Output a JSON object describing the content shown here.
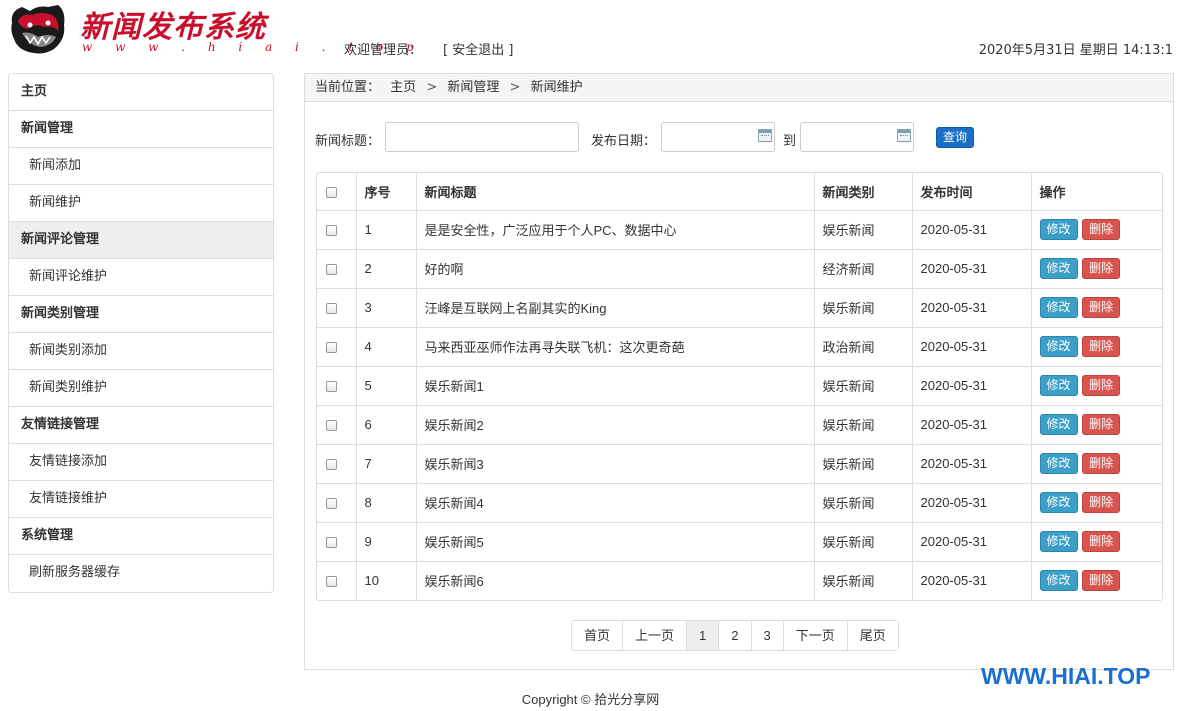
{
  "header": {
    "brand_title": "新闻发布系统",
    "brand_url": "w w w . h i a i . t o p",
    "welcome": "欢迎管理员：",
    "logout": "[ 安全退出 ]",
    "datetime": "2020年5月31日 星期日 14:13:1"
  },
  "sidebar": {
    "items": [
      {
        "label": "主页"
      },
      {
        "label": "新闻管理"
      },
      {
        "label": "新闻添加"
      },
      {
        "label": "新闻维护"
      },
      {
        "label": "新闻评论管理"
      },
      {
        "label": "新闻评论维护"
      },
      {
        "label": "新闻类别管理"
      },
      {
        "label": "新闻类别添加"
      },
      {
        "label": "新闻类别维护"
      },
      {
        "label": "友情链接管理"
      },
      {
        "label": "友情链接添加"
      },
      {
        "label": "友情链接维护"
      },
      {
        "label": "系统管理"
      },
      {
        "label": "刷新服务器缓存"
      }
    ]
  },
  "breadcrumb": {
    "prefix": "当前位置：",
    "items": [
      "主页",
      "新闻管理",
      "新闻维护"
    ],
    "sep": ">"
  },
  "search": {
    "title_label": "新闻标题：",
    "title_value": "",
    "date_label": "发布日期：",
    "date_from": "",
    "to_label": "到",
    "date_to": "",
    "query_label": "查询"
  },
  "table": {
    "headers": [
      "序号",
      "新闻标题",
      "新闻类别",
      "发布时间",
      "操作"
    ],
    "rows": [
      {
        "no": "1",
        "title": "是是安全性，广泛应用于个人PC、数据中心",
        "category": "娱乐新闻",
        "date": "2020-05-31"
      },
      {
        "no": "2",
        "title": "好的啊",
        "category": "经济新闻",
        "date": "2020-05-31"
      },
      {
        "no": "3",
        "title": "汪峰是互联网上名副其实的King",
        "category": "娱乐新闻",
        "date": "2020-05-31"
      },
      {
        "no": "4",
        "title": "马来西亚巫师作法再寻失联飞机：这次更奇葩",
        "category": "政治新闻",
        "date": "2020-05-31"
      },
      {
        "no": "5",
        "title": "娱乐新闻1",
        "category": "娱乐新闻",
        "date": "2020-05-31"
      },
      {
        "no": "6",
        "title": "娱乐新闻2",
        "category": "娱乐新闻",
        "date": "2020-05-31"
      },
      {
        "no": "7",
        "title": "娱乐新闻3",
        "category": "娱乐新闻",
        "date": "2020-05-31"
      },
      {
        "no": "8",
        "title": "娱乐新闻4",
        "category": "娱乐新闻",
        "date": "2020-05-31"
      },
      {
        "no": "9",
        "title": "娱乐新闻5",
        "category": "娱乐新闻",
        "date": "2020-05-31"
      },
      {
        "no": "10",
        "title": "娱乐新闻6",
        "category": "娱乐新闻",
        "date": "2020-05-31"
      }
    ],
    "edit_label": "修改",
    "delete_label": "删除"
  },
  "pager": {
    "first": "首页",
    "prev": "上一页",
    "pages": [
      "1",
      "2",
      "3"
    ],
    "current": "1",
    "next": "下一页",
    "last": "尾页"
  },
  "footer": {
    "copyright": "Copyright © 拾光分享网"
  },
  "watermark": "WWW.HIAI.TOP",
  "colors": {
    "brand": "#c8102e",
    "query": "#1a6fc7",
    "edit": "#3b9fc7",
    "delete": "#d9534f",
    "watermark": "#1a6fd1"
  }
}
